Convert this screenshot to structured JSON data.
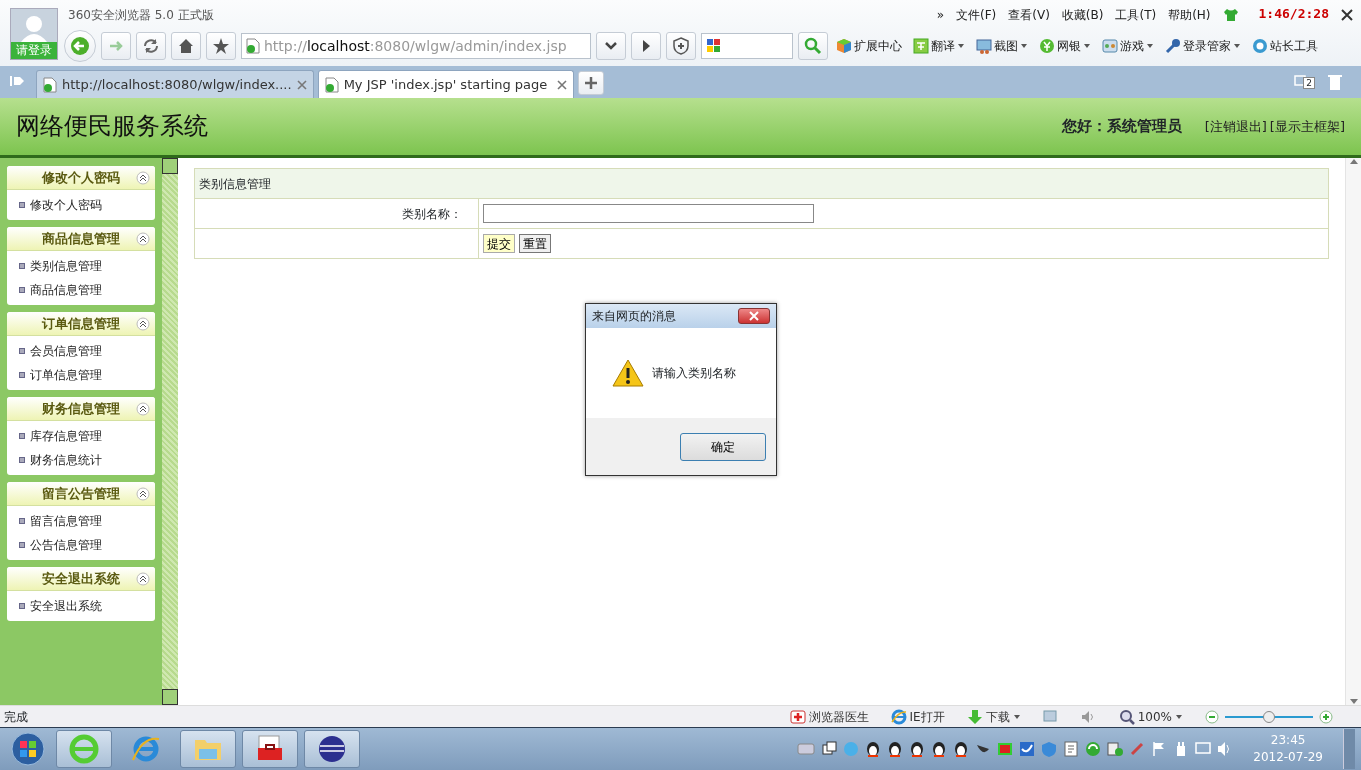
{
  "browser": {
    "title": "360安全浏览器 5.0 正式版",
    "login_label": "请登录",
    "menu_more": "»",
    "menu": [
      "文件(F)",
      "查看(V)",
      "收藏(B)",
      "工具(T)",
      "帮助(H)"
    ],
    "recording_timer": "1:46/2:28",
    "address": {
      "scheme": "http://",
      "host": "localhost",
      "rest": ":8080/wlgw/admin/index.jsp"
    },
    "toolbar_items": [
      {
        "label": "扩展中心",
        "dropdown": false
      },
      {
        "label": "翻译",
        "dropdown": true
      },
      {
        "label": "截图",
        "dropdown": true
      },
      {
        "label": "网银",
        "dropdown": true
      },
      {
        "label": "游戏",
        "dropdown": true
      },
      {
        "label": "登录管家",
        "dropdown": true
      },
      {
        "label": "站长工具",
        "dropdown": false
      }
    ],
    "tabs": [
      {
        "label": "http://localhost:8080/wlgw/index....",
        "selected": false
      },
      {
        "label": "My JSP 'index.jsp' starting page",
        "selected": true
      }
    ],
    "closed_tabs_count": "2"
  },
  "page": {
    "title": "网络便民服务系统",
    "greeting": "您好：系统管理员",
    "links": [
      "[注销退出]",
      "[显示主框架]"
    ],
    "sidebar": [
      {
        "title": "修改个人密码",
        "items": [
          "修改个人密码"
        ]
      },
      {
        "title": "商品信息管理",
        "items": [
          "类别信息管理",
          "商品信息管理"
        ]
      },
      {
        "title": "订单信息管理",
        "items": [
          "会员信息管理",
          "订单信息管理"
        ]
      },
      {
        "title": "财务信息管理",
        "items": [
          "库存信息管理",
          "财务信息统计"
        ]
      },
      {
        "title": "留言公告管理",
        "items": [
          "留言信息管理",
          "公告信息管理"
        ]
      },
      {
        "title": "安全退出系统",
        "items": [
          "安全退出系统"
        ]
      }
    ],
    "form": {
      "heading": "类别信息管理",
      "field_label": "类别名称：",
      "buttons": [
        {
          "label": "提交",
          "focused": true
        },
        {
          "label": "重置",
          "focused": false
        }
      ]
    }
  },
  "dialog": {
    "title": "来自网页的消息",
    "message": "请输入类别名称",
    "button": "确定"
  },
  "status_bar": {
    "text": "完成",
    "items": [
      "浏览器医生",
      "IE打开",
      "下载"
    ],
    "zoom": "100%",
    "level": 0.5
  },
  "taskbar": {
    "apps": [
      {
        "running": true
      },
      {
        "running": false
      },
      {
        "running": true
      },
      {
        "running": true
      },
      {
        "running": true
      }
    ],
    "time": "23:45",
    "date": "2012-07-29"
  }
}
